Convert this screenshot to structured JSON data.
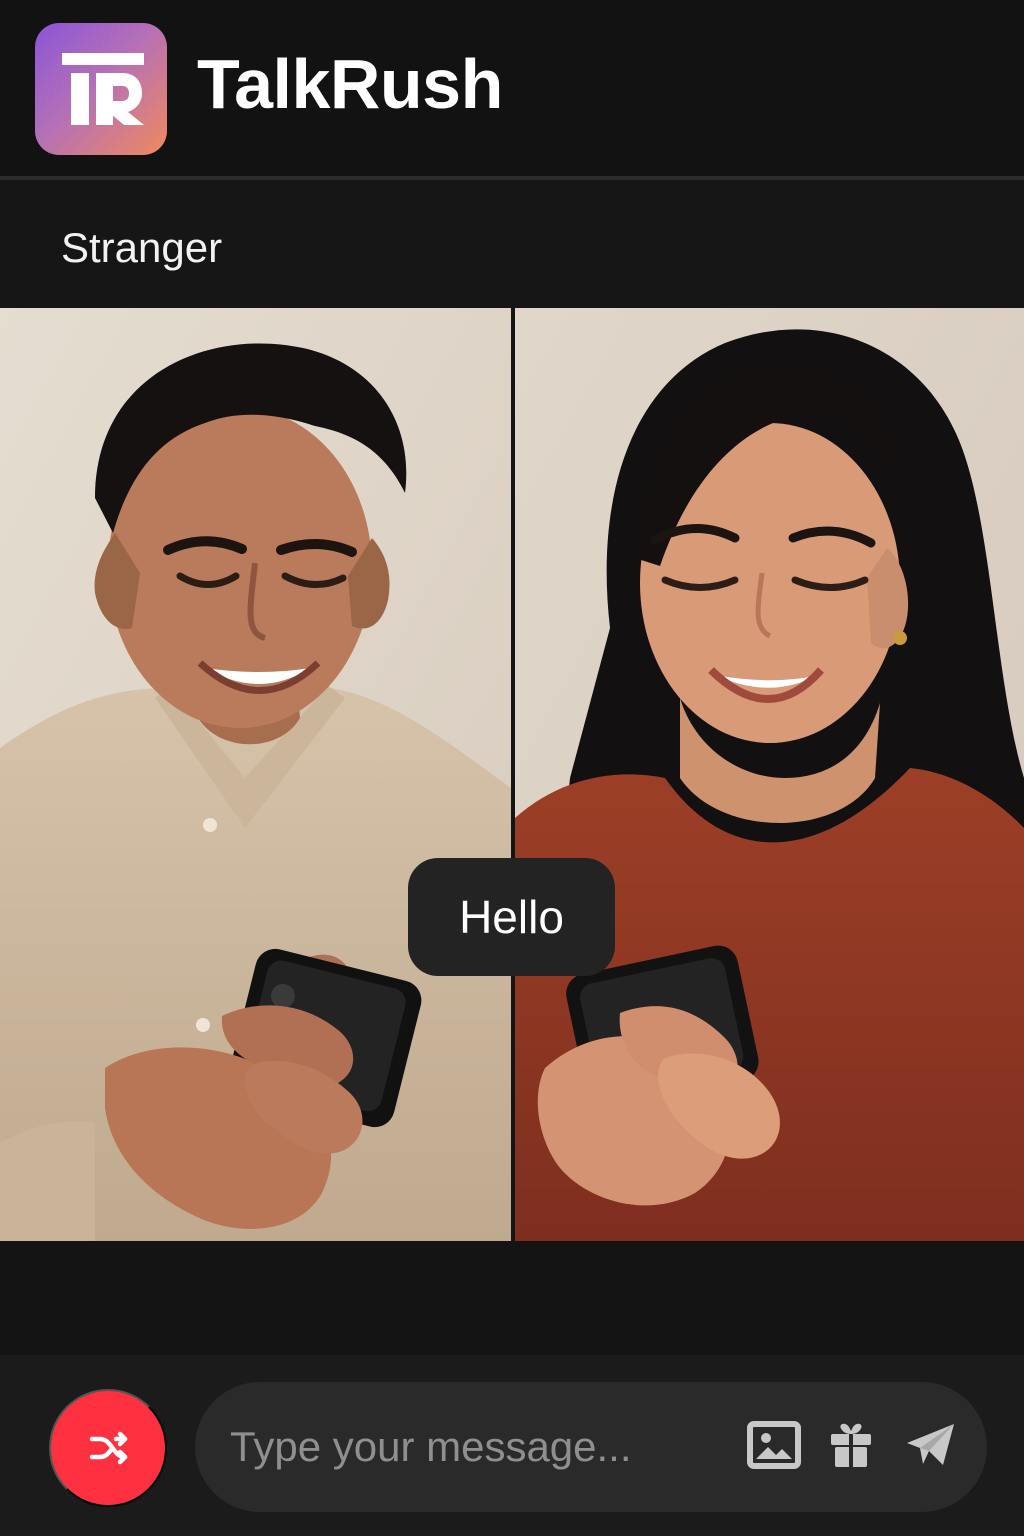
{
  "header": {
    "logo_text": "TR",
    "app_title": "TalkRush"
  },
  "conversation": {
    "participant_label": "Stranger",
    "last_message": "Hello"
  },
  "composer": {
    "placeholder": "Type your message..."
  },
  "icons": {
    "shuffle": "shuffle-icon",
    "image": "image-icon",
    "gift": "gift-icon",
    "send": "send-icon"
  },
  "colors": {
    "background": "#121212",
    "shuffle_button": "#ff3040",
    "input_pill": "#2a2a2a",
    "chat_bubble": "#232323",
    "logo_gradient_start": "#8a55d6",
    "logo_gradient_end": "#f08a5d"
  },
  "media": {
    "left_participant": "man using smartphone",
    "right_participant": "woman using smartphone"
  }
}
